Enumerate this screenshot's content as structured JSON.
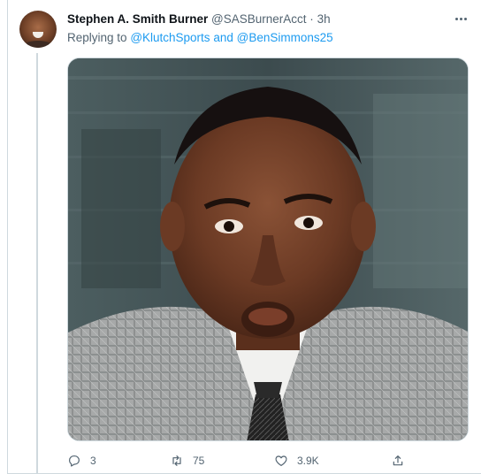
{
  "tweet": {
    "display_name": "Stephen A. Smith Burner",
    "handle": "@SASBurnerAcct",
    "separator": "·",
    "time": "3h",
    "replying_prefix": "Replying to",
    "mention_1": "@KlutchSports",
    "conjunction": "and",
    "mention_2": "@BenSimmons25"
  },
  "actions": {
    "reply_count": "3",
    "retweet_count": "75",
    "like_count": "3.9K"
  },
  "icons": {
    "more": "more-horizontal-icon",
    "reply": "reply-bubble-icon",
    "retweet": "retweet-arrows-icon",
    "like": "heart-icon",
    "share": "share-upload-icon"
  },
  "colors": {
    "link": "#1d9bf0",
    "secondary_text": "#536471",
    "primary_text": "#0f1419",
    "border": "#cfd9de"
  }
}
